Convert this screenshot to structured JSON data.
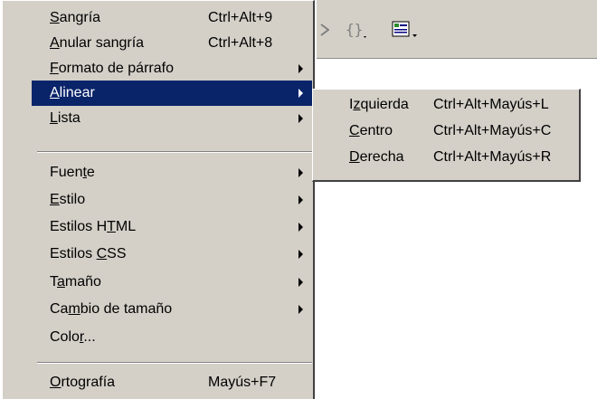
{
  "toolbar": {
    "icons": [
      "play-icon",
      "braces-icon",
      "list-icon"
    ]
  },
  "menu": {
    "items": [
      {
        "pre": "",
        "u": "S",
        "post": "angría",
        "shortcut": "Ctrl+Alt+9"
      },
      {
        "pre": "",
        "u": "A",
        "post": "nular sangría",
        "shortcut": "Ctrl+Alt+8"
      },
      {
        "pre": "",
        "u": "F",
        "post": "ormato de párrafo",
        "shortcut": ""
      },
      {
        "pre": "",
        "u": "A",
        "post": "linear",
        "shortcut": ""
      },
      {
        "pre": "",
        "u": "L",
        "post": "ista",
        "shortcut": ""
      },
      {
        "pre": "Fuen",
        "u": "t",
        "post": "e",
        "shortcut": ""
      },
      {
        "pre": "",
        "u": "E",
        "post": "stilo",
        "shortcut": ""
      },
      {
        "pre": "Estilos H",
        "u": "T",
        "post": "ML",
        "shortcut": ""
      },
      {
        "pre": "Estilos ",
        "u": "C",
        "post": "SS",
        "shortcut": ""
      },
      {
        "pre": "T",
        "u": "a",
        "post": "maño",
        "shortcut": ""
      },
      {
        "pre": "Ca",
        "u": "m",
        "post": "bio de tamaño",
        "shortcut": ""
      },
      {
        "pre": "Colo",
        "u": "r",
        "post": "...",
        "shortcut": ""
      },
      {
        "pre": "",
        "u": "O",
        "post": "rtografía",
        "shortcut": "Mayús+F7"
      }
    ]
  },
  "submenu": {
    "items": [
      {
        "pre": "I",
        "u": "z",
        "post": "quierda",
        "shortcut": "Ctrl+Alt+Mayús+L"
      },
      {
        "pre": "",
        "u": "C",
        "post": "entro",
        "shortcut": "Ctrl+Alt+Mayús+C"
      },
      {
        "pre": "",
        "u": "D",
        "post": "erecha",
        "shortcut": "Ctrl+Alt+Mayús+R"
      }
    ]
  }
}
